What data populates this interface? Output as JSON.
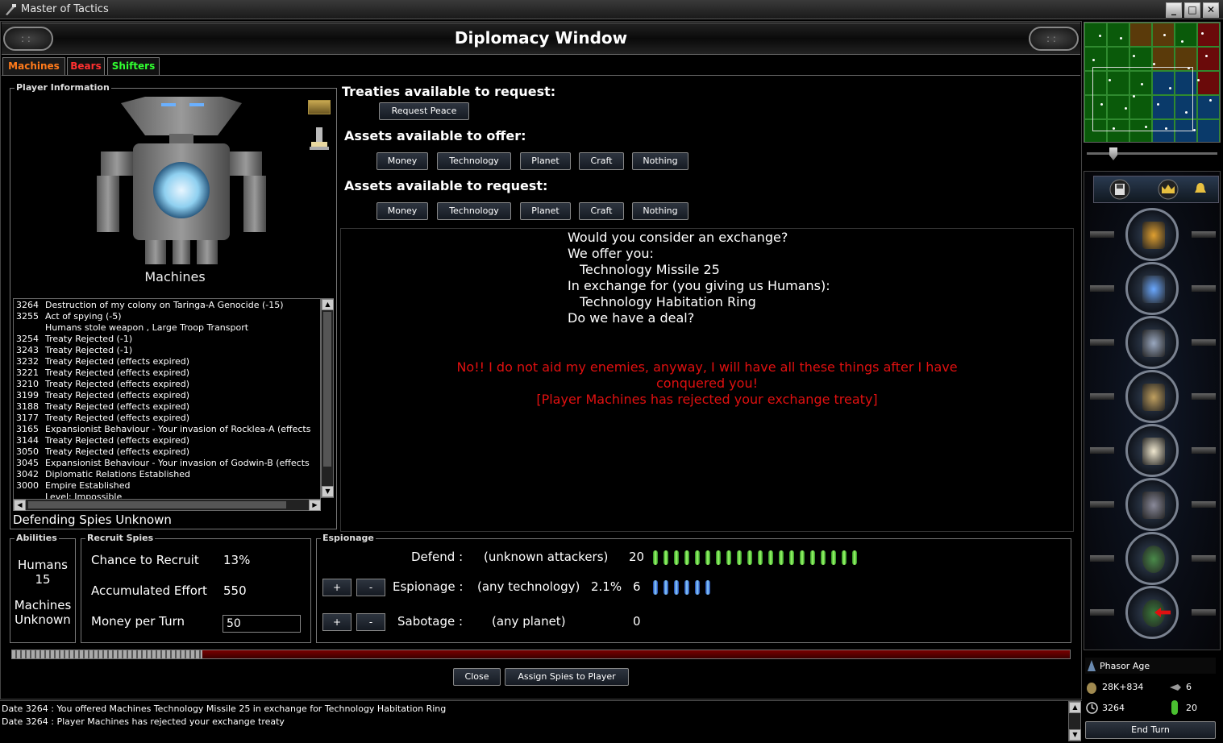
{
  "window": {
    "title": "Master of Tactics"
  },
  "header": {
    "title": "Diplomacy Window"
  },
  "tabs": [
    {
      "label": "Machines",
      "color": "#ff7a1a"
    },
    {
      "label": "Bears",
      "color": "#ff3030"
    },
    {
      "label": "Shifters",
      "color": "#30ff30"
    }
  ],
  "player_info": {
    "group_label": "Player Information",
    "race_name": "Machines",
    "log": [
      {
        "date": "3264",
        "text": "Destruction of my colony on Taringa-A Genocide (-15)"
      },
      {
        "date": "3255",
        "text": "Act of spying (-5)"
      },
      {
        "date": "",
        "text": "Humans stole weapon , Large Troop Transport"
      },
      {
        "date": "3254",
        "text": "Treaty Rejected (-1)"
      },
      {
        "date": "3243",
        "text": "Treaty Rejected (-1)"
      },
      {
        "date": "3232",
        "text": "Treaty Rejected (effects expired)"
      },
      {
        "date": "3221",
        "text": "Treaty Rejected (effects expired)"
      },
      {
        "date": "3210",
        "text": "Treaty Rejected (effects expired)"
      },
      {
        "date": "3199",
        "text": "Treaty Rejected (effects expired)"
      },
      {
        "date": "3188",
        "text": "Treaty Rejected (effects expired)"
      },
      {
        "date": "3177",
        "text": "Treaty Rejected (effects expired)"
      },
      {
        "date": "3165",
        "text": "Expansionist Behaviour - Your invasion of Rocklea-A (effects"
      },
      {
        "date": "3144",
        "text": "Treaty Rejected (effects expired)"
      },
      {
        "date": "3050",
        "text": "Treaty Rejected (effects expired)"
      },
      {
        "date": "3045",
        "text": "Expansionist Behaviour - Your invasion of Godwin-B (effects"
      },
      {
        "date": "3042",
        "text": "Diplomatic Relations Established"
      },
      {
        "date": "3000",
        "text": "Empire Established"
      },
      {
        "date": "",
        "text": "Level: Impossible"
      }
    ],
    "defending_spies": "Defending Spies Unknown"
  },
  "treaties": {
    "request_label": "Treaties available to request:",
    "request_peace": "Request Peace",
    "offer_label": "Assets available to offer:",
    "offer_buttons": [
      "Money",
      "Technology",
      "Planet",
      "Craft",
      "Nothing"
    ],
    "assets_request_label": "Assets available to request:",
    "request_buttons": [
      "Money",
      "Technology",
      "Planet",
      "Craft",
      "Nothing"
    ]
  },
  "message": {
    "lines": [
      "Would you consider an exchange?",
      "We offer you:",
      "  Technology Missile 25",
      "In exchange for (you giving us Humans):",
      "  Technology Habitation Ring",
      "Do we have a deal?"
    ],
    "reply_lines": [
      "No!! I do not aid my enemies, anyway, I will have all these things after I have",
      "conquered you!",
      "[Player Machines has rejected your exchange treaty]"
    ]
  },
  "abilities": {
    "label": "Abilities",
    "race1": "Humans",
    "race1_value": "15",
    "race2": "Machines",
    "race2_value": "Unknown"
  },
  "recruit": {
    "label": "Recruit Spies",
    "chance_label": "Chance to Recruit",
    "chance_value": "13%",
    "effort_label": "Accumulated Effort",
    "effort_value": "550",
    "money_label": "Money per Turn",
    "money_value": "50"
  },
  "espionage": {
    "label": "Espionage",
    "defend_label": "Defend :",
    "defend_target": "(unknown attackers)",
    "defend_count": "20",
    "espionage_label": "Espionage :",
    "espionage_target": "(any technology)",
    "espionage_pct": "2.1%",
    "espionage_count": "6",
    "sabotage_label": "Sabotage :",
    "sabotage_target": "(any planet)",
    "sabotage_count": "0",
    "plus": "+",
    "minus": "-"
  },
  "progress": {
    "fraction": 0.18
  },
  "buttons": {
    "close": "Close",
    "assign": "Assign Spies to Player"
  },
  "status_log": [
    "Date 3264 : You offered Machines Technology Missile 25 in exchange for Technology Habitation Ring",
    "Date 3264 : Player Machines has rejected your exchange treaty"
  ],
  "side_status": {
    "age": "Phasor Age",
    "money": "28K+834",
    "ships": "6",
    "date": "3264",
    "spies": "20",
    "end_turn": "End Turn"
  }
}
